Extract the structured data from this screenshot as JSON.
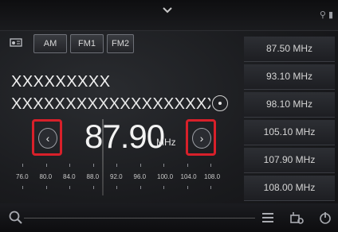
{
  "bands": [
    {
      "label": "AM"
    },
    {
      "label": "FM1"
    },
    {
      "label": "FM2"
    }
  ],
  "station": {
    "name": "XXXXXXXXX",
    "info": "XXXXXXXXXXXXXXXXXXXXX"
  },
  "tuner": {
    "frequency": "87.90",
    "unit": "MHz",
    "scale": [
      "76.0",
      "80.0",
      "84.0",
      "88.0",
      "92.0",
      "96.0",
      "100.0",
      "104.0",
      "108.0"
    ]
  },
  "presets": [
    {
      "label": "87.50 MHz"
    },
    {
      "label": "93.10 MHz"
    },
    {
      "label": "98.10 MHz"
    },
    {
      "label": "105.10 MHz"
    },
    {
      "label": "107.90 MHz"
    },
    {
      "label": "108.00 MHz"
    }
  ],
  "icons": {
    "top": "chevron-down-icon",
    "source": "radio-icon",
    "search": "search-icon",
    "list": "list-icon",
    "settings": "settings-icon",
    "power": "power-icon"
  },
  "colors": {
    "highlight": "#d8202a"
  }
}
